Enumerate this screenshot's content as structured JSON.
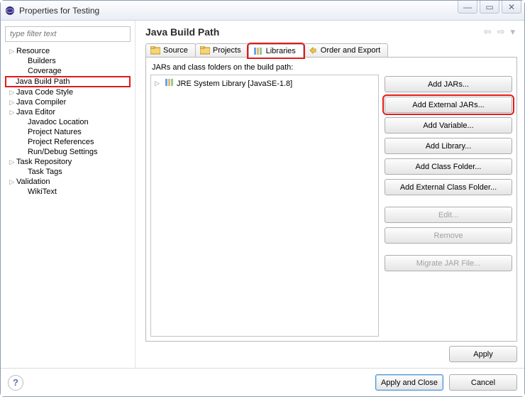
{
  "window": {
    "title": "Properties for Testing"
  },
  "sidebar": {
    "filter_placeholder": "type filter text",
    "items": [
      {
        "label": "Resource",
        "expandable": true
      },
      {
        "label": "Builders",
        "expandable": false
      },
      {
        "label": "Coverage",
        "expandable": false
      },
      {
        "label": "Java Build Path",
        "expandable": false,
        "selected": true
      },
      {
        "label": "Java Code Style",
        "expandable": true
      },
      {
        "label": "Java Compiler",
        "expandable": true
      },
      {
        "label": "Java Editor",
        "expandable": true
      },
      {
        "label": "Javadoc Location",
        "expandable": false
      },
      {
        "label": "Project Natures",
        "expandable": false
      },
      {
        "label": "Project References",
        "expandable": false
      },
      {
        "label": "Run/Debug Settings",
        "expandable": false
      },
      {
        "label": "Task Repository",
        "expandable": true
      },
      {
        "label": "Task Tags",
        "expandable": false
      },
      {
        "label": "Validation",
        "expandable": true
      },
      {
        "label": "WikiText",
        "expandable": false
      }
    ]
  },
  "main": {
    "title": "Java Build Path",
    "tabs": {
      "source": "Source",
      "projects": "Projects",
      "libraries": "Libraries",
      "order": "Order and Export"
    },
    "desc": "JARs and class folders on the build path:",
    "tree_root": "JRE System Library [JavaSE-1.8]",
    "buttons": {
      "add_jars": "Add JARs...",
      "add_ext_jars": "Add External JARs...",
      "add_variable": "Add Variable...",
      "add_library": "Add Library...",
      "add_class_folder": "Add Class Folder...",
      "add_ext_class_folder": "Add External Class Folder...",
      "edit": "Edit...",
      "remove": "Remove",
      "migrate": "Migrate JAR File..."
    },
    "apply": "Apply"
  },
  "footer": {
    "apply_close": "Apply and Close",
    "cancel": "Cancel"
  }
}
